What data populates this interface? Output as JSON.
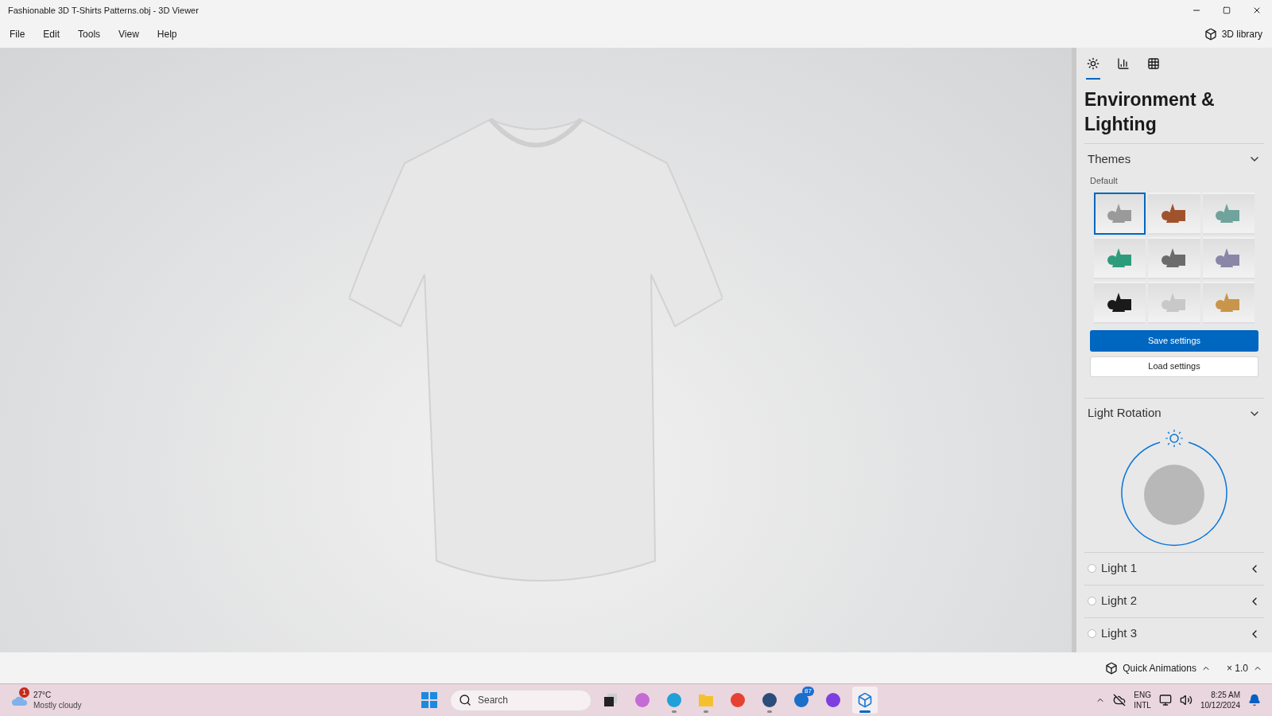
{
  "window": {
    "title": "Fashionable 3D T-Shirts Patterns.obj - 3D Viewer"
  },
  "menu": [
    "File",
    "Edit",
    "Tools",
    "View",
    "Help"
  ],
  "library_button": "3D library",
  "panel": {
    "tabs": [
      {
        "kind": "lighting",
        "selected": true
      },
      {
        "kind": "stats",
        "selected": false
      },
      {
        "kind": "grid",
        "selected": false
      }
    ],
    "title": "Environment & Lighting",
    "themes": {
      "label": "Themes",
      "expanded": true,
      "caption": "Default",
      "items": [
        {
          "color": "#9a9a9a",
          "selected": true
        },
        {
          "color": "#a0522d",
          "selected": false
        },
        {
          "color": "#6fa39c",
          "selected": false
        },
        {
          "color": "#2e9c7c",
          "selected": false
        },
        {
          "color": "#6b6b6b",
          "selected": false
        },
        {
          "color": "#8a86a8",
          "selected": false
        },
        {
          "color": "#1a1a1a",
          "selected": false
        },
        {
          "color": "#c8c8c8",
          "selected": false
        },
        {
          "color": "#c8954a",
          "selected": false
        }
      ]
    },
    "save_button": "Save settings",
    "load_button": "Load settings",
    "rotation": {
      "label": "Light Rotation",
      "expanded": true
    },
    "lights": [
      {
        "label": "Light 1",
        "on": false
      },
      {
        "label": "Light 2",
        "on": false
      },
      {
        "label": "Light 3",
        "on": false
      }
    ]
  },
  "bottom_bar": {
    "animations": "Quick Animations",
    "speed": "× 1.0"
  },
  "taskbar": {
    "weather": {
      "temp": "27°C",
      "desc": "Mostly cloudy",
      "badge": "1"
    },
    "search": "Search",
    "apps": [
      {
        "kind": "taskview",
        "running": false,
        "active": false
      },
      {
        "kind": "copilot",
        "running": false,
        "active": false
      },
      {
        "kind": "edge",
        "running": true,
        "active": false
      },
      {
        "kind": "files",
        "running": true,
        "active": false
      },
      {
        "kind": "chrome",
        "running": false,
        "active": false
      },
      {
        "kind": "store",
        "running": true,
        "active": false
      },
      {
        "kind": "outlook",
        "running": false,
        "active": false,
        "badge": "87"
      },
      {
        "kind": "canva",
        "running": false,
        "active": false
      },
      {
        "kind": "viewer",
        "running": true,
        "active": true
      }
    ],
    "lang": [
      "ENG",
      "INTL"
    ],
    "time": "8:25 AM",
    "date": "10/12/2024"
  }
}
